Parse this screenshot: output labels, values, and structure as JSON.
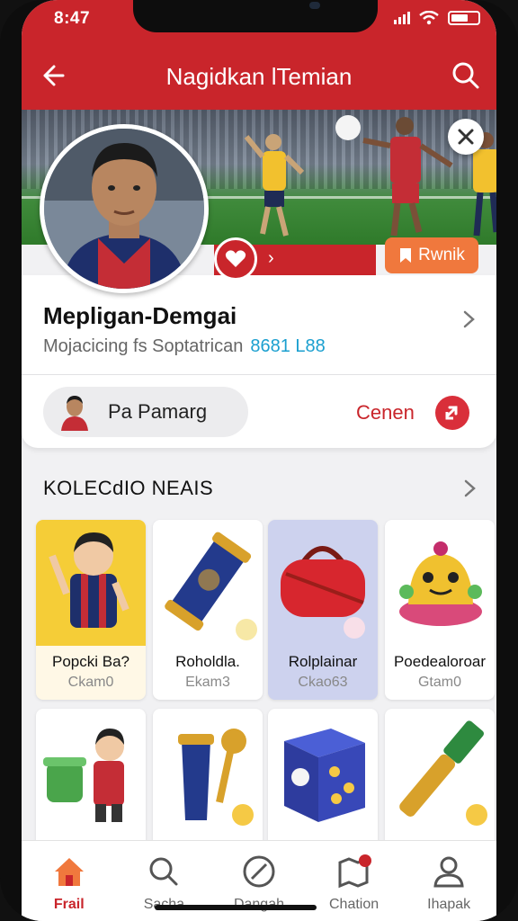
{
  "status": {
    "time": "8:47"
  },
  "header": {
    "title": "Nagidkan lTemian"
  },
  "hero": {
    "cta_label": "Rwnik"
  },
  "profile": {
    "name": "Mepligan-Demgai",
    "subtitle": "Mojacicing fs Soptatrican",
    "subtitle_highlight": "8681 L88",
    "player_chip_label": "Pa Pamarg",
    "cancel_label": "Cenen"
  },
  "collection": {
    "title": "KOLECdIO NEAIS",
    "items": [
      {
        "name": "Popcki Ba?",
        "price": "Ckam0"
      },
      {
        "name": "Roholdla.",
        "price": "Ekam3"
      },
      {
        "name": "Rolplainar",
        "price": "Ckao63"
      },
      {
        "name": "Poedealoroar",
        "price": "Gtam0"
      },
      {
        "name": "",
        "price": ""
      },
      {
        "name": "",
        "price": ""
      },
      {
        "name": "",
        "price": ""
      },
      {
        "name": "",
        "price": ""
      }
    ]
  },
  "bottom_nav": {
    "items": [
      {
        "label": "Frail",
        "icon": "home-icon",
        "active": true
      },
      {
        "label": "Sacha",
        "icon": "search-icon",
        "active": false
      },
      {
        "label": "Dangah",
        "icon": "compass-icon",
        "active": false
      },
      {
        "label": "Chation",
        "icon": "map-icon",
        "active": false
      },
      {
        "label": "Ihapak",
        "icon": "person-icon",
        "active": false
      }
    ]
  },
  "colors": {
    "brand_red": "#c9252b",
    "accent_orange": "#f0783d",
    "highlight_blue": "#1a9fcf"
  }
}
